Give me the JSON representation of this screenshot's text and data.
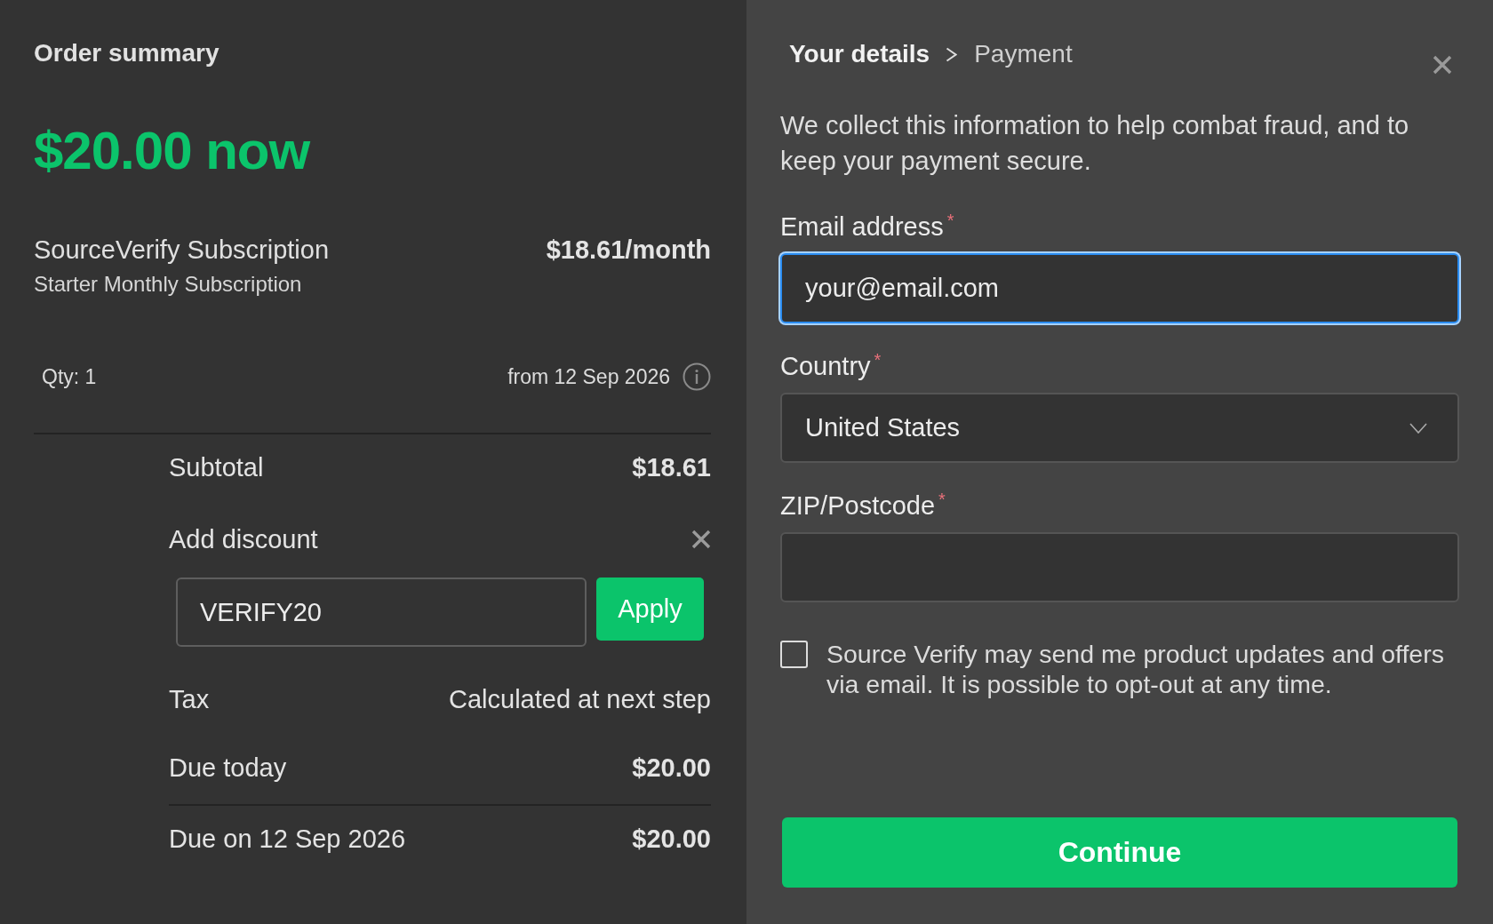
{
  "order_summary": {
    "title": "Order summary",
    "amount_now": "$20.00 now",
    "product": {
      "name": "SourceVerify Subscription",
      "plan": "Starter Monthly Subscription",
      "price": "$18.61/month",
      "quantity": "Qty: 1",
      "start_date": "from 12 Sep 2026"
    },
    "subtotal": {
      "label": "Subtotal",
      "value": "$18.61"
    },
    "discount": {
      "label": "Add discount",
      "code": "VERIFY20",
      "button": "Apply"
    },
    "totals": [
      {
        "label": "Tax",
        "value": "Calculated at next step",
        "kind": "note"
      },
      {
        "label": "Due today",
        "value": "$20.00",
        "kind": "due"
      },
      {
        "label": "Due on 12 Sep 2026",
        "value": "$20.00",
        "kind": "scheduled"
      }
    ]
  },
  "details": {
    "breadcrumb": [
      {
        "label": "Your details",
        "selected": true
      },
      {
        "label": "Payment",
        "selected": false
      }
    ],
    "intro": "We collect this information to help combat fraud, and to keep your payment secure.",
    "fields": [
      {
        "kind": "text",
        "label": "Email address",
        "required_mark": "*",
        "value": "your@email.com",
        "focused": true
      },
      {
        "kind": "select",
        "label": "Country",
        "required_mark": "*",
        "value": "United States",
        "focused": false
      },
      {
        "kind": "text",
        "label": "ZIP/Postcode",
        "required_mark": "*",
        "focused": false
      }
    ],
    "consent": {
      "checked": false,
      "text": "Source Verify may send me product updates and offers via email. It is possible to opt-out at any time."
    },
    "button": "Continue"
  }
}
